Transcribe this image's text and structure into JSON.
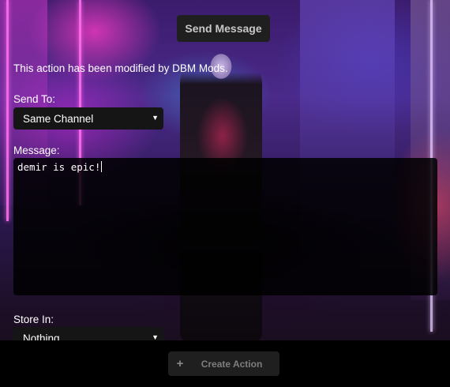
{
  "header": {
    "button_label": "Send Message"
  },
  "notice": "This action has been modified by DBM Mods.",
  "send_to": {
    "label": "Send To:",
    "value": "Same Channel"
  },
  "message": {
    "label": "Message:",
    "value": "demir is epic!"
  },
  "store_in": {
    "label": "Store In:",
    "value": "Nothing"
  },
  "footer": {
    "create_label": "Create Action",
    "plus_icon": "plus-icon"
  },
  "colors": {
    "panel": "#1f1f1f",
    "input_bg": "#151515",
    "footer_bg": "#000000"
  }
}
